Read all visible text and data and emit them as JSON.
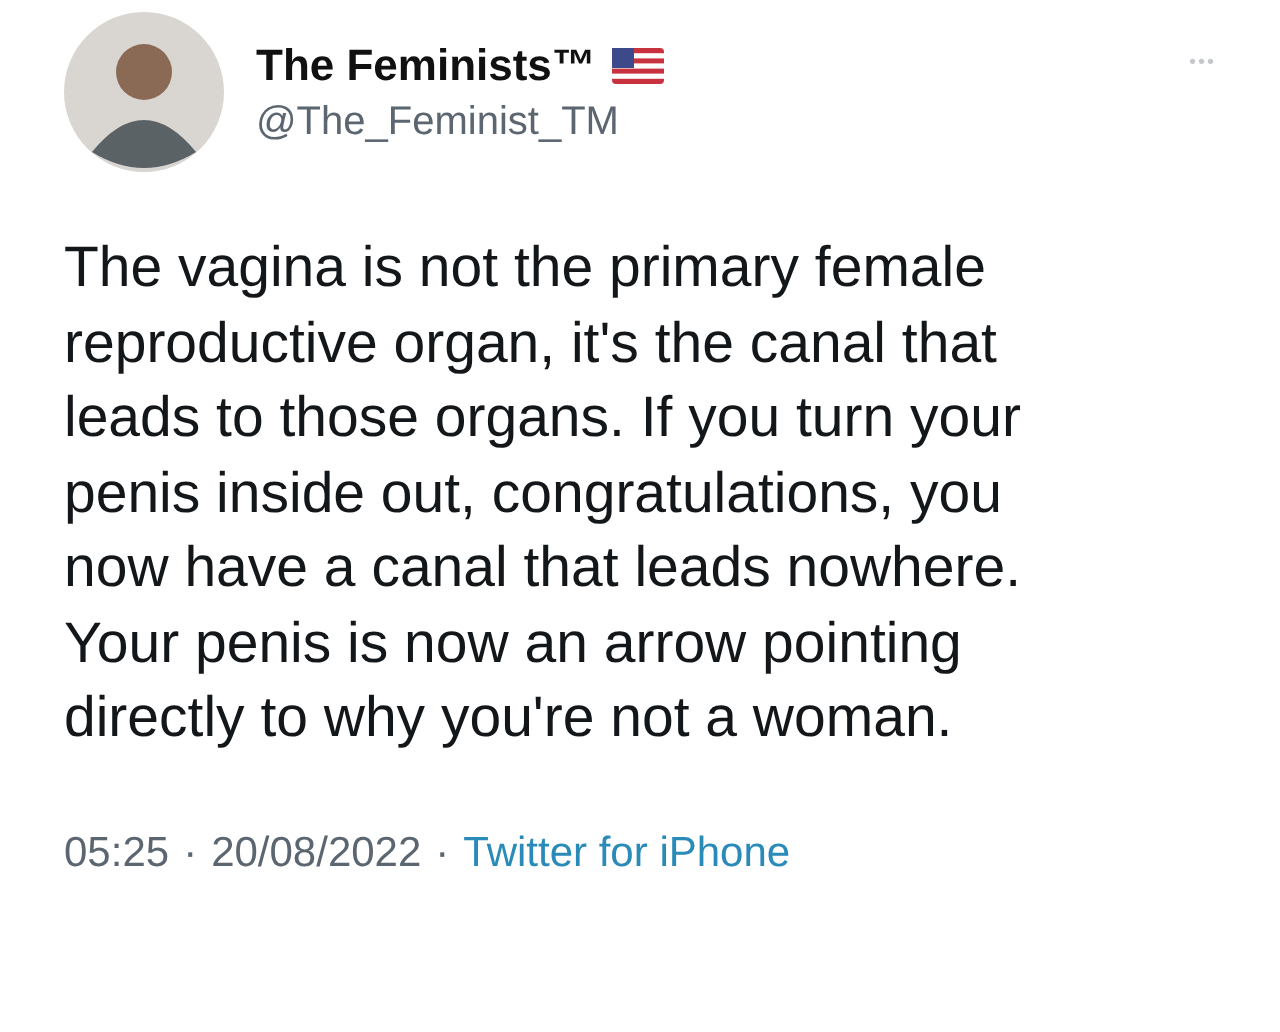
{
  "author": {
    "name": "The Feminists™",
    "handle": "@The_Feminist_TM",
    "more": "•••"
  },
  "tweet": {
    "lines": [
      "The vagina is not the primary female",
      "reproductive organ, it's the canal that",
      "leads to those organs. If you turn your",
      "penis inside out, congratulations, you",
      "now have a canal that leads nowhere.",
      "Your penis is now an arrow pointing",
      "directly to why you're not a woman."
    ]
  },
  "footer": {
    "time": "05:25",
    "separator": "·",
    "date": "20/08/2022",
    "separator_2": "·",
    "source": "Twitter for iPhone"
  }
}
